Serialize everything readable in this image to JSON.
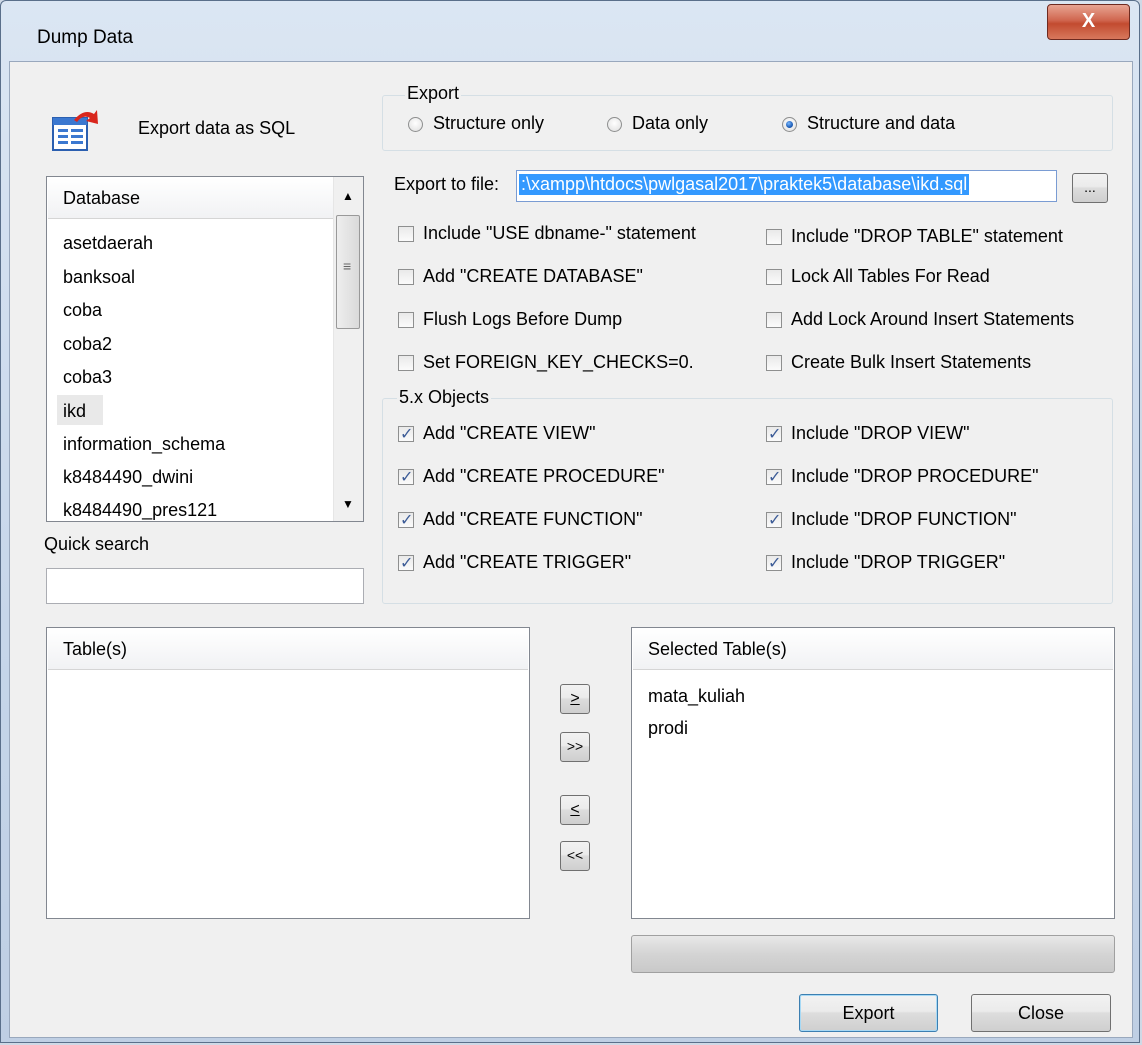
{
  "window": {
    "title": "Dump Data",
    "close_label": "X"
  },
  "header": {
    "label": "Export data as SQL",
    "icon": "sql-export-icon"
  },
  "export_group": {
    "caption": "Export",
    "options": [
      {
        "label": "Structure only",
        "selected": false
      },
      {
        "label": "Data only",
        "selected": false
      },
      {
        "label": "Structure and data",
        "selected": true
      }
    ]
  },
  "export_file": {
    "label": "Export to file:",
    "value": ":\\xampp\\htdocs\\pwlgasal2017\\praktek5\\database\\ikd.sql",
    "browse_label": "..."
  },
  "database_list": {
    "header": "Database",
    "items": [
      "asetdaerah",
      "banksoal",
      "coba",
      "coba2",
      "coba3",
      "ikd",
      "information_schema",
      "k8484490_dwini",
      "k8484490_pres121"
    ],
    "selected": "ikd"
  },
  "quick_search": {
    "label": "Quick search",
    "value": ""
  },
  "options": {
    "left": [
      {
        "label": "Include \"USE dbname-\" statement",
        "checked": false
      },
      {
        "label": "Add \"CREATE DATABASE\"",
        "checked": false
      },
      {
        "label": "Flush Logs Before Dump",
        "checked": false
      },
      {
        "label": "Set FOREIGN_KEY_CHECKS=0.",
        "checked": false
      }
    ],
    "right": [
      {
        "label": "Include \"DROP TABLE\" statement",
        "checked": false
      },
      {
        "label": "Lock All Tables For Read",
        "checked": false
      },
      {
        "label": "Add Lock Around Insert Statements",
        "checked": false
      },
      {
        "label": "Create Bulk Insert Statements",
        "checked": false
      }
    ]
  },
  "objects_group": {
    "caption": "5.x Objects",
    "left": [
      {
        "label": "Add \"CREATE VIEW\"",
        "checked": true
      },
      {
        "label": "Add \"CREATE PROCEDURE\"",
        "checked": true
      },
      {
        "label": "Add \"CREATE FUNCTION\"",
        "checked": true
      },
      {
        "label": "Add \"CREATE TRIGGER\"",
        "checked": true
      }
    ],
    "right": [
      {
        "label": "Include \"DROP VIEW\"",
        "checked": true
      },
      {
        "label": "Include \"DROP PROCEDURE\"",
        "checked": true
      },
      {
        "label": "Include \"DROP FUNCTION\"",
        "checked": true
      },
      {
        "label": "Include \"DROP TRIGGER\"",
        "checked": true
      }
    ]
  },
  "tables_list": {
    "header": "Table(s)",
    "items": []
  },
  "selected_tables_list": {
    "header": "Selected Table(s)",
    "items": [
      "mata_kuliah",
      "prodi"
    ]
  },
  "transfer_buttons": {
    "add_one": ">",
    "add_all": ">>",
    "remove_one": "<",
    "remove_all": "<<"
  },
  "progress": {
    "value": 0
  },
  "footer": {
    "export_label": "Export",
    "close_label": "Close"
  }
}
